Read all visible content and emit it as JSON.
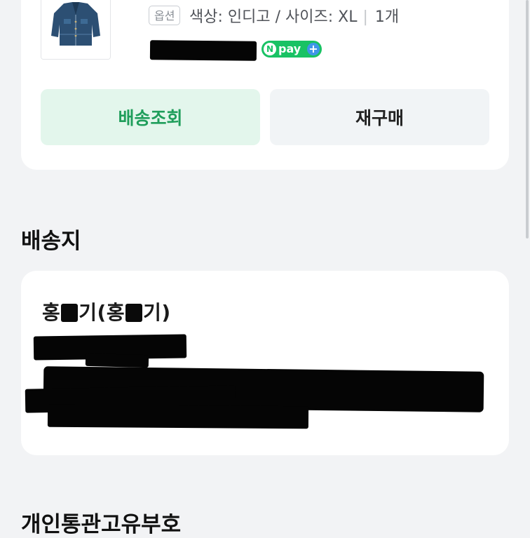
{
  "order": {
    "option_badge": "옵션",
    "option_text": "색상: 인디고 / 사이즈: XL",
    "quantity": "1개",
    "price_redacted": true,
    "npay_label": "pay",
    "npay_n": "N",
    "npay_plus": "+",
    "buttons": {
      "track": "배송조회",
      "rebuy": "재구매"
    }
  },
  "address": {
    "section_title": "배송지",
    "recipient_part1": "홍",
    "recipient_part2": "기(홍",
    "recipient_part3": "기)",
    "details_redacted": true
  },
  "customs": {
    "section_title": "개인통관고유부호"
  },
  "colors": {
    "background": "#f2f3f5",
    "card": "#ffffff",
    "track_button_bg": "#e3f6ec",
    "track_button_text": "#1f9e5b",
    "rebuy_button_bg": "#f1f4f6",
    "npay_green": "#19c264",
    "npay_plus_blue": "#3f96e8"
  },
  "icons": {
    "product_thumbnail": "denim-jacket-image",
    "npay": "npay-plus-logo"
  }
}
